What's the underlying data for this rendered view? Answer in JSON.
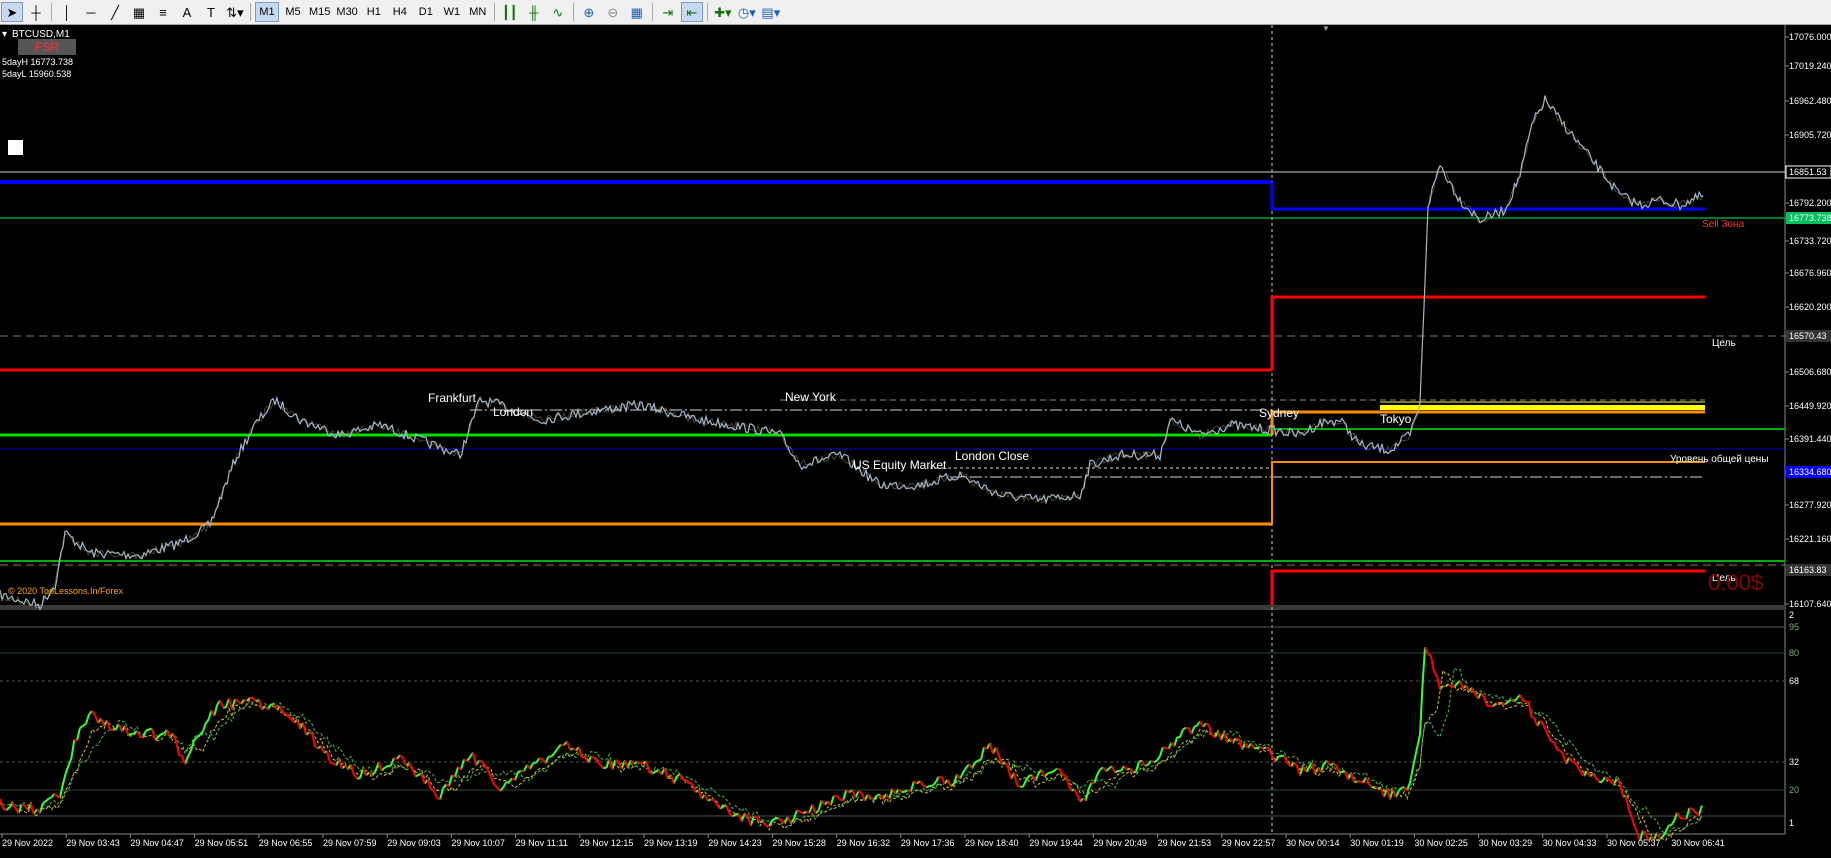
{
  "toolbar": {
    "timeframes": [
      "M1",
      "M5",
      "M15",
      "M30",
      "H1",
      "H4",
      "D1",
      "W1",
      "MN"
    ],
    "active_timeframe": "M1"
  },
  "chart": {
    "symbol_title": "BTCUSD,M1",
    "fsr_label": "FSR",
    "five_day_high": "5dayH 16773.738",
    "five_day_low": "5dayL 15960.538",
    "copyright": "© 2020 TopLessons.In/Forex",
    "profit": "0.00$",
    "sessions": [
      "Frankfurt",
      "London",
      "New York",
      "US Equity Market",
      "London Close",
      "Sydney",
      "Tokyo"
    ],
    "level_labels": {
      "sell_zone": "Sell Зона",
      "target_top": "Цель",
      "general_price": "Уровень общей цены",
      "target_bottom": "Цель"
    },
    "price_axis": [
      "17076.000",
      "17019.240",
      "16962.480",
      "16905.720",
      "16851.53",
      "16792.200",
      "16773.738",
      "16733.720",
      "16676.960",
      "16620.200",
      "16570.43",
      "16506.680",
      "16449.920",
      "16391.440",
      "16334.680",
      "16277.920",
      "16221.160",
      "16163.83",
      "16107.640"
    ],
    "current_price": "16851.53",
    "indicator_axis": [
      "2",
      "95",
      "80",
      "68",
      "32",
      "20",
      "1"
    ],
    "time_axis": [
      "29 Nov 2022",
      "29 Nov 03:43",
      "29 Nov 04:47",
      "29 Nov 05:51",
      "29 Nov 06:55",
      "29 Nov 07:59",
      "29 Nov 09:03",
      "29 Nov 10:07",
      "29 Nov 11:11",
      "29 Nov 12:15",
      "29 Nov 13:19",
      "29 Nov 14:23",
      "29 Nov 15:28",
      "29 Nov 16:32",
      "29 Nov 17:36",
      "29 Nov 18:40",
      "29 Nov 19:44",
      "29 Nov 20:49",
      "29 Nov 21:53",
      "29 Nov 22:57",
      "30 Nov 00:14",
      "30 Nov 01:19",
      "30 Nov 02:25",
      "30 Nov 03:29",
      "30 Nov 04:33",
      "30 Nov 05:37",
      "30 Nov 06:41"
    ]
  },
  "colors": {
    "background": "#000000",
    "price_line": "#9fb8d8",
    "resistance_blue": "#0000ff",
    "support_green": "#00d000",
    "level_red": "#ff0000",
    "level_orange": "#ff8c00",
    "level_yellow": "#ffff00",
    "indicator_up": "#33ff33",
    "indicator_down": "#ff0000",
    "grid": "#3a3a3a"
  }
}
